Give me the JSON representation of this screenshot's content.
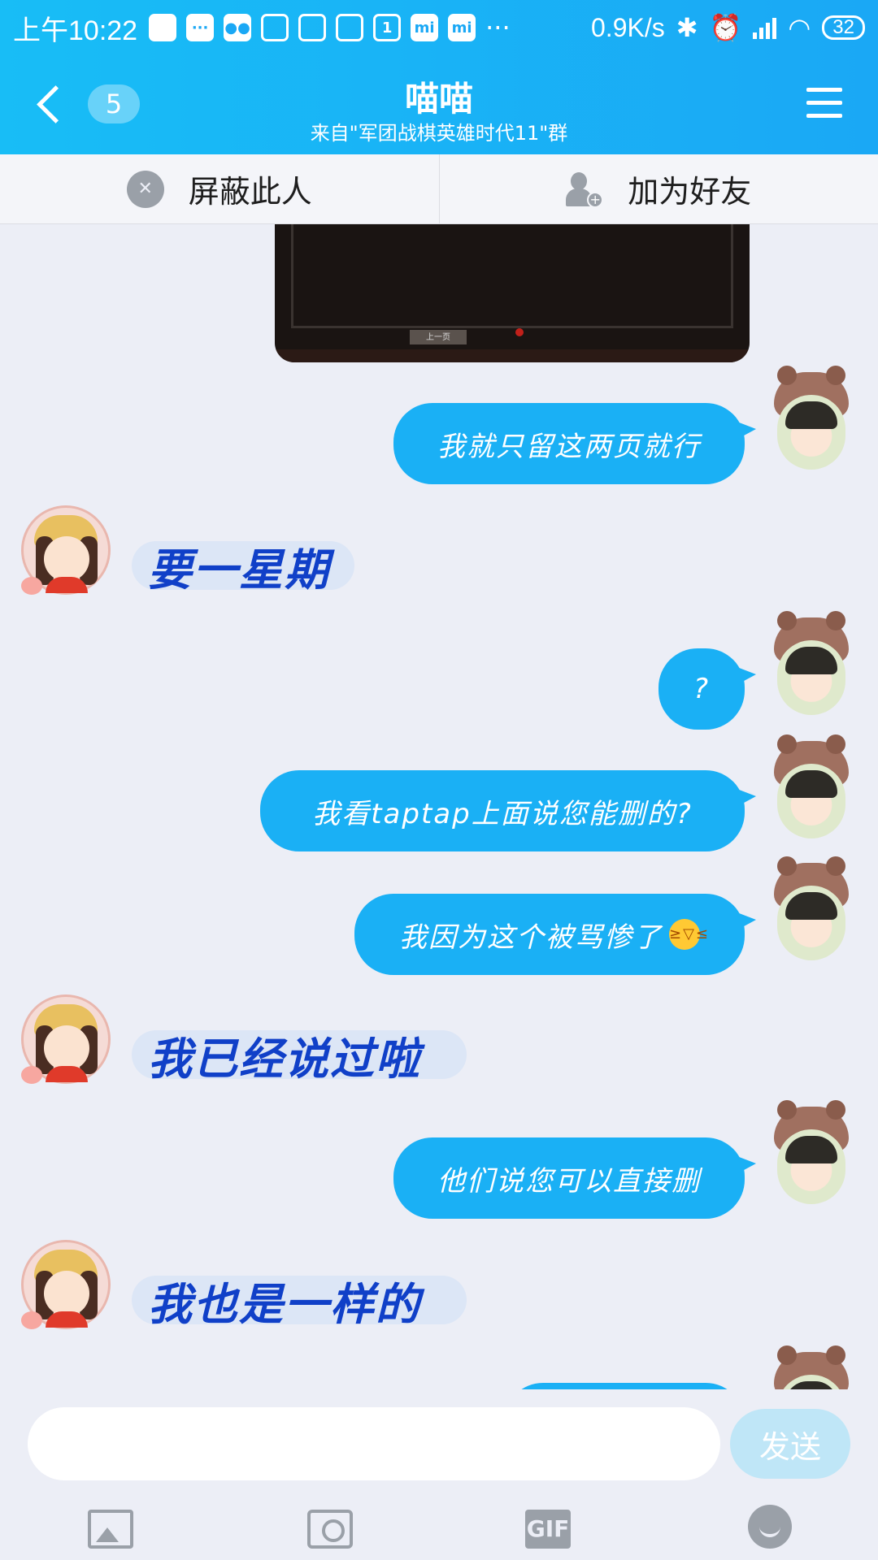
{
  "status_bar": {
    "time": "上午10:22",
    "network_speed": "0.9K/s",
    "battery": "32",
    "icons": [
      "app-icon",
      "message-icon",
      "wechat-icon",
      "trash-icon",
      "trash-icon",
      "radio-icon",
      "calendar-icon",
      "mi-icon",
      "mi-icon",
      "more-icon",
      "bluetooth-icon",
      "alarm-icon",
      "signal-icon",
      "wifi-icon",
      "battery-icon"
    ],
    "calendar_day": "1",
    "more": "···"
  },
  "header": {
    "unread_count": "5",
    "title": "喵喵",
    "subtitle": "来自\"军团战棋英雄时代11\"群"
  },
  "actions": {
    "block_label": "屏蔽此人",
    "add_friend_label": "加为好友"
  },
  "messages": [
    {
      "side": "right",
      "type": "image",
      "button_text": "上一页"
    },
    {
      "side": "right",
      "type": "text",
      "text": "我就只留这两页就行"
    },
    {
      "side": "left",
      "type": "sticker",
      "text": "要一星期"
    },
    {
      "side": "right",
      "type": "text",
      "text": "?"
    },
    {
      "side": "right",
      "type": "text",
      "text": "我看taptap上面说您能删的?"
    },
    {
      "side": "right",
      "type": "text",
      "text": "我因为这个被骂惨了",
      "emoji": "laugh-cry-emoji"
    },
    {
      "side": "left",
      "type": "sticker",
      "text": "我已经说过啦"
    },
    {
      "side": "right",
      "type": "text",
      "text": "他们说您可以直接删"
    },
    {
      "side": "left",
      "type": "sticker",
      "text": "我也是一样的"
    }
  ],
  "input": {
    "value": "",
    "send_label": "发送"
  },
  "toolbar": {
    "gif_label": "GIF",
    "tools": [
      "image-icon",
      "camera-icon",
      "gif-icon",
      "emoji-icon"
    ]
  },
  "colors": {
    "header": "#18bdf6",
    "bubble": "#1ab0f5",
    "background": "#eceef6",
    "sticker_text": "#1040c8"
  }
}
